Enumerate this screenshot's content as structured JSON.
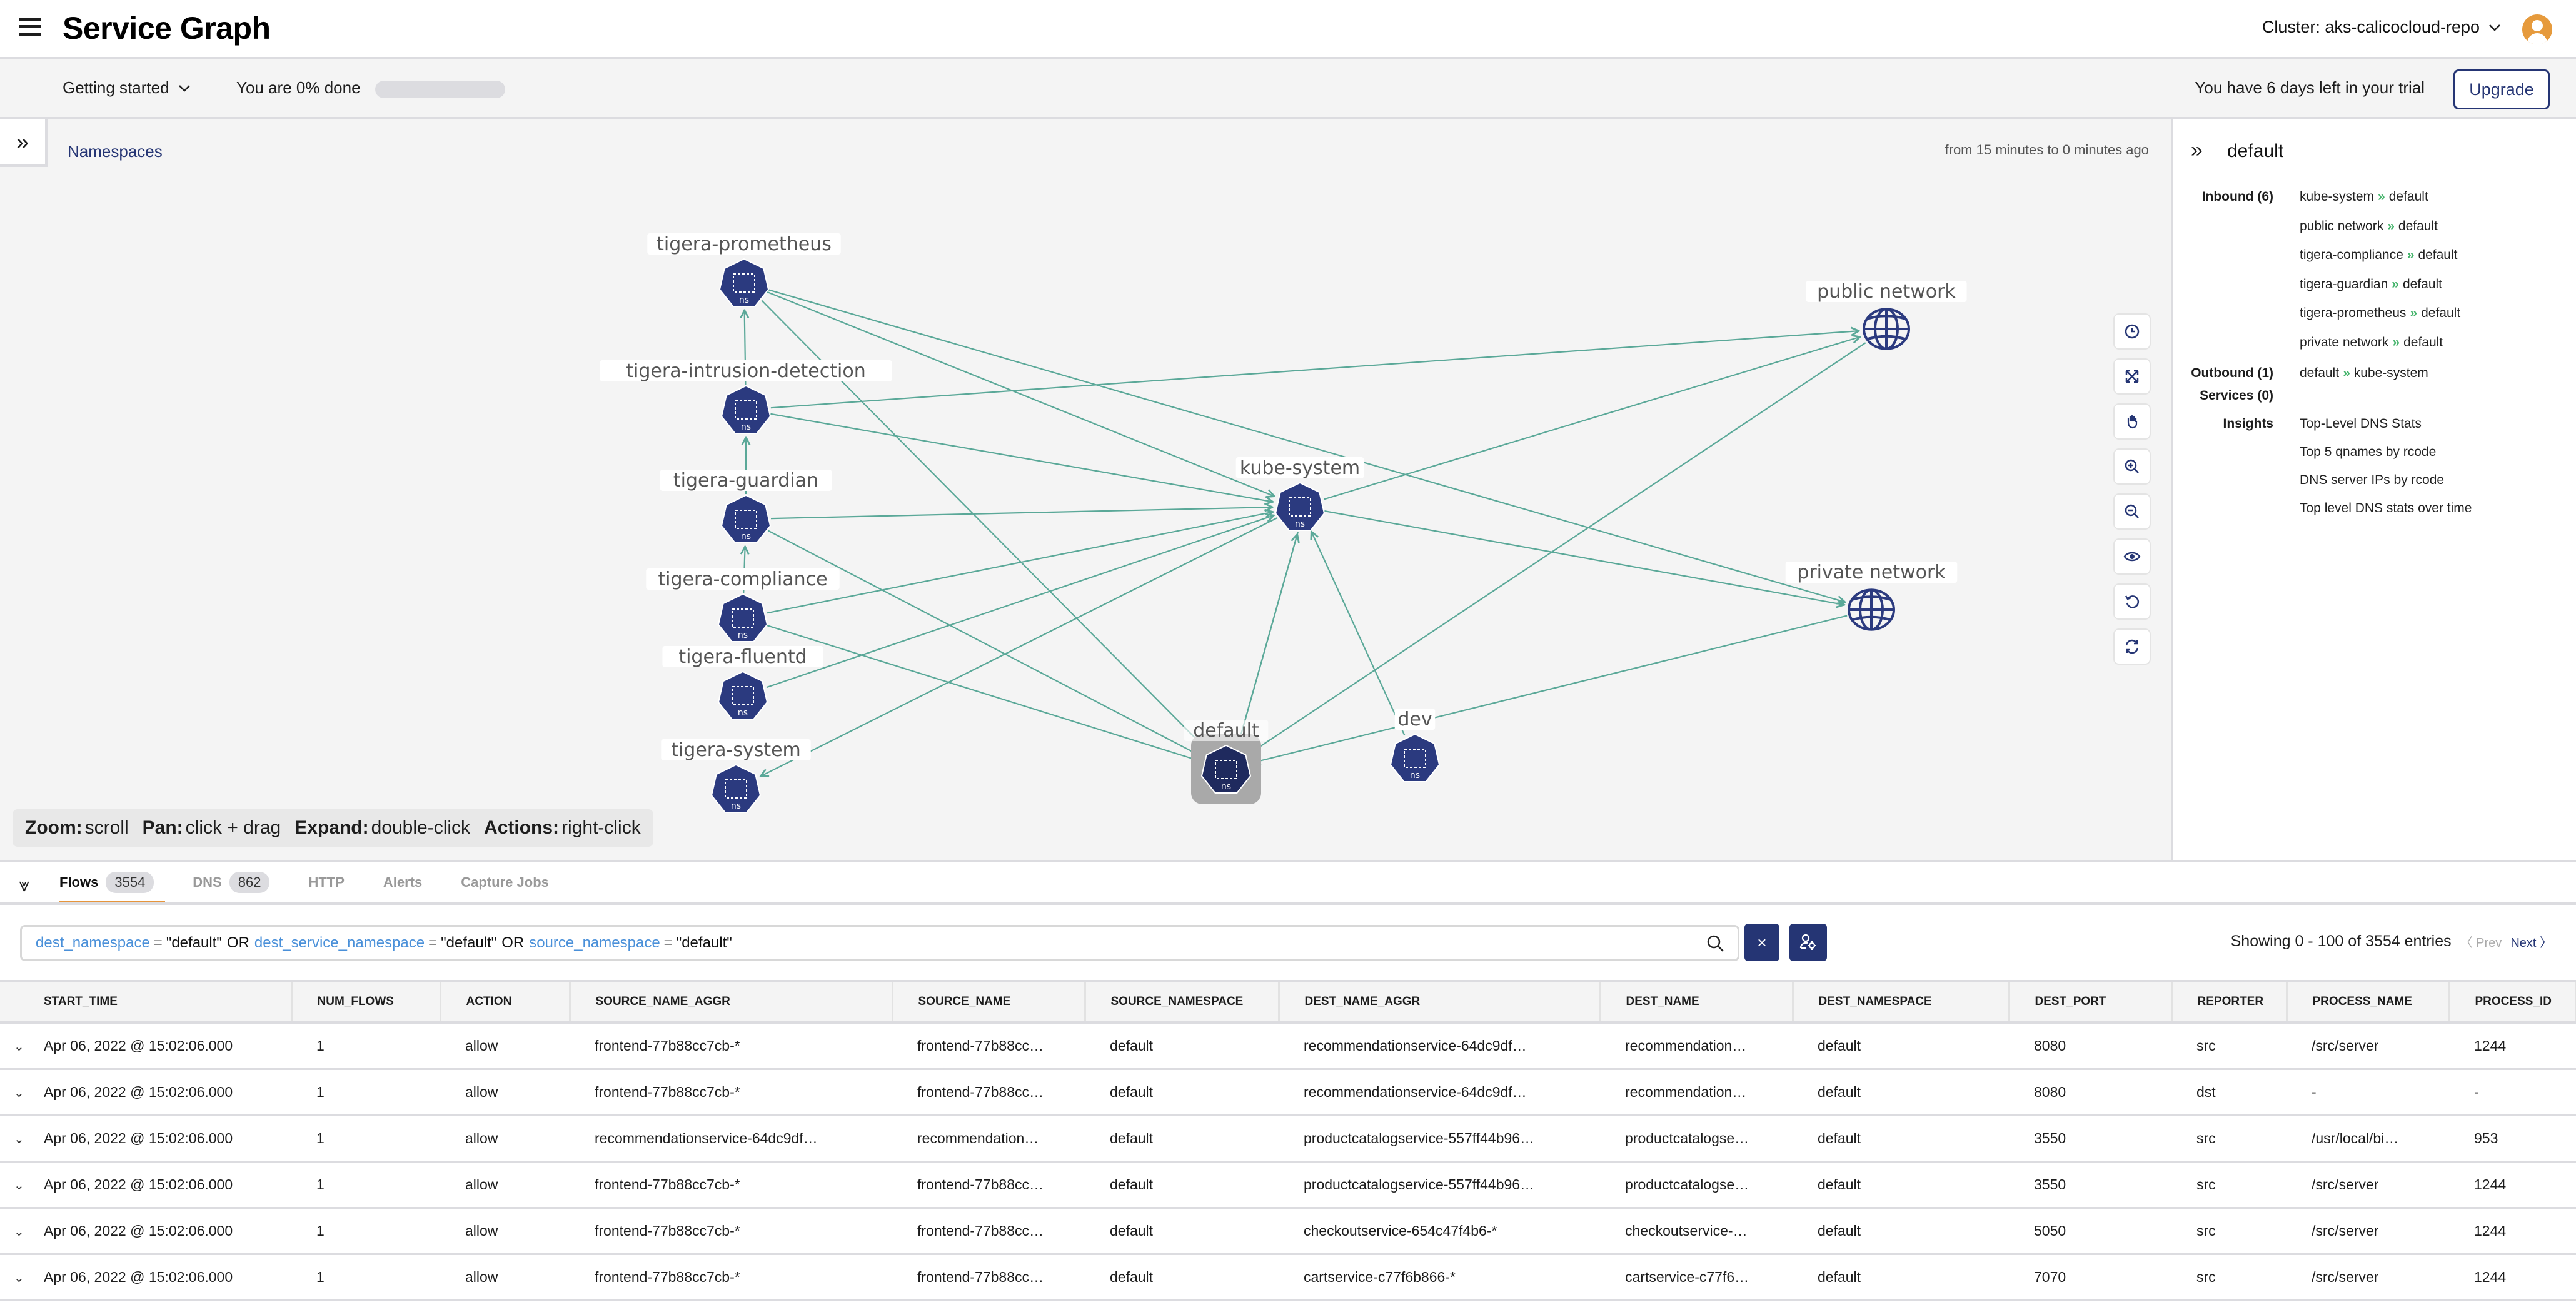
{
  "header": {
    "title": "Service Graph",
    "cluster_label": "Cluster: aks-calicocloud-repo"
  },
  "getting_started": {
    "dropdown_label": "Getting started",
    "progress_label": "You are 0% done",
    "progress_percent": 0,
    "trial_text": "You have 6 days left in your trial",
    "upgrade_label": "Upgrade"
  },
  "graph": {
    "breadcrumb": "Namespaces",
    "time_range": "from 15 minutes to 0 minutes ago",
    "node_type_label": "ns",
    "selected_node": "default",
    "nodes": [
      {
        "id": "tigera-prometheus",
        "label": "tigera-prometheus",
        "kind": "namespace"
      },
      {
        "id": "tigera-intrusion-detection",
        "label": "tigera-intrusion-detection",
        "kind": "namespace"
      },
      {
        "id": "tigera-guardian",
        "label": "tigera-guardian",
        "kind": "namespace"
      },
      {
        "id": "tigera-compliance",
        "label": "tigera-compliance",
        "kind": "namespace"
      },
      {
        "id": "tigera-fluentd",
        "label": "tigera-fluentd",
        "kind": "namespace"
      },
      {
        "id": "tigera-system",
        "label": "tigera-system",
        "kind": "namespace"
      },
      {
        "id": "kube-system",
        "label": "kube-system",
        "kind": "namespace"
      },
      {
        "id": "default",
        "label": "default",
        "kind": "namespace"
      },
      {
        "id": "dev",
        "label": "dev",
        "kind": "namespace"
      },
      {
        "id": "public-network",
        "label": "public network",
        "kind": "network"
      },
      {
        "id": "private-network",
        "label": "private network",
        "kind": "network"
      }
    ],
    "edges": [
      {
        "from": "tigera-intrusion-detection",
        "to": "tigera-prometheus"
      },
      {
        "from": "tigera-guardian",
        "to": "tigera-intrusion-detection"
      },
      {
        "from": "tigera-compliance",
        "to": "tigera-guardian"
      },
      {
        "from": "tigera-prometheus",
        "to": "kube-system"
      },
      {
        "from": "tigera-prometheus",
        "to": "private-network"
      },
      {
        "from": "tigera-prometheus",
        "to": "default"
      },
      {
        "from": "tigera-intrusion-detection",
        "to": "public-network"
      },
      {
        "from": "tigera-intrusion-detection",
        "to": "kube-system"
      },
      {
        "from": "tigera-guardian",
        "to": "kube-system"
      },
      {
        "from": "tigera-guardian",
        "to": "default"
      },
      {
        "from": "tigera-compliance",
        "to": "kube-system"
      },
      {
        "from": "tigera-compliance",
        "to": "default"
      },
      {
        "from": "tigera-fluentd",
        "to": "kube-system"
      },
      {
        "from": "kube-system",
        "to": "tigera-system"
      },
      {
        "from": "kube-system",
        "to": "public-network"
      },
      {
        "from": "kube-system",
        "to": "private-network"
      },
      {
        "from": "kube-system",
        "to": "default"
      },
      {
        "from": "default",
        "to": "kube-system"
      },
      {
        "from": "dev",
        "to": "kube-system"
      },
      {
        "from": "public-network",
        "to": "default"
      },
      {
        "from": "private-network",
        "to": "default"
      }
    ],
    "controls": [
      {
        "name": "time-travel-button",
        "icon": "clock-icon"
      },
      {
        "name": "fit-to-screen-button",
        "icon": "expand-arrows-icon"
      },
      {
        "name": "pan-mode-button",
        "icon": "hand-icon"
      },
      {
        "name": "zoom-in-button",
        "icon": "zoom-in-icon"
      },
      {
        "name": "zoom-out-button",
        "icon": "zoom-out-icon"
      },
      {
        "name": "view-options-button",
        "icon": "eye-icon"
      },
      {
        "name": "reset-layout-button",
        "icon": "undo-icon"
      },
      {
        "name": "refresh-button",
        "icon": "refresh-icon"
      }
    ],
    "hints": [
      {
        "key": "Zoom:",
        "value": "scroll"
      },
      {
        "key": "Pan:",
        "value": "click + drag"
      },
      {
        "key": "Expand:",
        "value": "double-click"
      },
      {
        "key": "Actions:",
        "value": "right-click"
      }
    ]
  },
  "details_panel": {
    "title": "default",
    "inbound_label": "Inbound (6)",
    "inbound": [
      {
        "from": "kube-system",
        "to": "default"
      },
      {
        "from": "public network",
        "to": "default"
      },
      {
        "from": "tigera-compliance",
        "to": "default"
      },
      {
        "from": "tigera-guardian",
        "to": "default"
      },
      {
        "from": "tigera-prometheus",
        "to": "default"
      },
      {
        "from": "private network",
        "to": "default"
      }
    ],
    "outbound_label": "Outbound (1)",
    "outbound": [
      {
        "from": "default",
        "to": "kube-system"
      }
    ],
    "services_label": "Services (0)",
    "insights_label": "Insights",
    "insights": [
      "Top-Level DNS Stats",
      "Top 5 qnames by rcode",
      "DNS server IPs by rcode",
      "Top level DNS stats over time"
    ],
    "arrow_glyph": "»",
    "arrow_color": "#43b36a"
  },
  "bottom": {
    "tabs": [
      {
        "label": "Flows",
        "count": "3554",
        "active": true
      },
      {
        "label": "DNS",
        "count": "862",
        "active": false
      },
      {
        "label": "HTTP",
        "count": null,
        "active": false
      },
      {
        "label": "Alerts",
        "count": null,
        "active": false
      },
      {
        "label": "Capture Jobs",
        "count": null,
        "active": false
      }
    ],
    "query": {
      "k1": "dest_namespace",
      "v1": "\"default\"",
      "or1": "OR",
      "k2": "dest_service_namespace",
      "v2": "\"default\"",
      "or2": "OR",
      "k3": "source_namespace",
      "v3": "\"default\"",
      "op": "="
    },
    "clear_label": "×",
    "paging_text": "Showing 0 - 100 of 3554 entries",
    "prev_label": "〈 Prev",
    "next_label": "Next 〉",
    "columns": [
      "START_TIME",
      "NUM_FLOWS",
      "ACTION",
      "SOURCE_NAME_AGGR",
      "SOURCE_NAME",
      "SOURCE_NAMESPACE",
      "DEST_NAME_AGGR",
      "DEST_NAME",
      "DEST_NAMESPACE",
      "DEST_PORT",
      "REPORTER",
      "PROCESS_NAME",
      "PROCESS_ID"
    ],
    "rows": [
      [
        "Apr 06, 2022 @ 15:02:06.000",
        "1",
        "allow",
        "frontend-77b88cc7cb-*",
        "frontend-77b88cc…",
        "default",
        "recommendationservice-64dc9df…",
        "recommendation…",
        "default",
        "8080",
        "src",
        "/src/server",
        "1244"
      ],
      [
        "Apr 06, 2022 @ 15:02:06.000",
        "1",
        "allow",
        "frontend-77b88cc7cb-*",
        "frontend-77b88cc…",
        "default",
        "recommendationservice-64dc9df…",
        "recommendation…",
        "default",
        "8080",
        "dst",
        "-",
        "-"
      ],
      [
        "Apr 06, 2022 @ 15:02:06.000",
        "1",
        "allow",
        "recommendationservice-64dc9df…",
        "recommendation…",
        "default",
        "productcatalogservice-557ff44b96…",
        "productcatalogse…",
        "default",
        "3550",
        "src",
        "/usr/local/bi…",
        "953"
      ],
      [
        "Apr 06, 2022 @ 15:02:06.000",
        "1",
        "allow",
        "frontend-77b88cc7cb-*",
        "frontend-77b88cc…",
        "default",
        "productcatalogservice-557ff44b96…",
        "productcatalogse…",
        "default",
        "3550",
        "src",
        "/src/server",
        "1244"
      ],
      [
        "Apr 06, 2022 @ 15:02:06.000",
        "1",
        "allow",
        "frontend-77b88cc7cb-*",
        "frontend-77b88cc…",
        "default",
        "checkoutservice-654c47f4b6-*",
        "checkoutservice-…",
        "default",
        "5050",
        "src",
        "/src/server",
        "1244"
      ],
      [
        "Apr 06, 2022 @ 15:02:06.000",
        "1",
        "allow",
        "frontend-77b88cc7cb-*",
        "frontend-77b88cc…",
        "default",
        "cartservice-c77f6b866-*",
        "cartservice-c77f6…",
        "default",
        "7070",
        "src",
        "/src/server",
        "1244"
      ]
    ]
  },
  "colors": {
    "brand_navy": "#253574",
    "node_fill": "#2b3a7f",
    "edge": "#5aa898",
    "accent_orange": "#e6953c",
    "avatar": "#e69a3c"
  }
}
